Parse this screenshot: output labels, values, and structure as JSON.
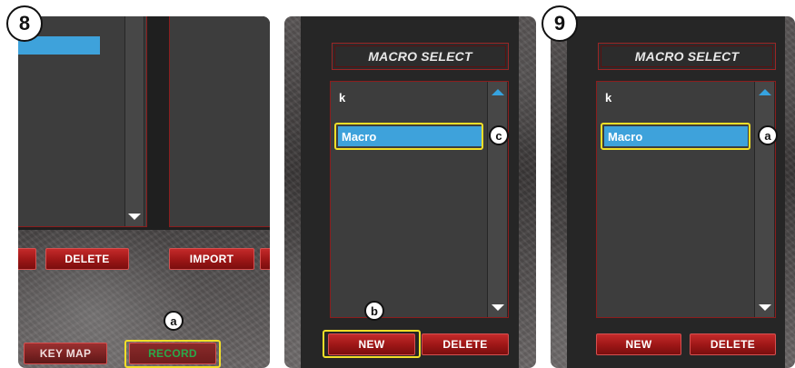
{
  "step8": {
    "badge": "8",
    "buttons": {
      "delete_label": "DELETE",
      "import_label": "IMPORT",
      "keymap_label": "KEY MAP",
      "record_label": "RECORD"
    },
    "callouts": {
      "a": "a"
    }
  },
  "panel_macro": {
    "title": "MACRO SELECT",
    "items": [
      {
        "label": "k"
      },
      {
        "label": "Macro"
      }
    ],
    "buttons": {
      "new_label": "NEW",
      "delete_label": "DELETE"
    },
    "callouts": {
      "b": "b",
      "c": "c"
    }
  },
  "step9": {
    "badge": "9",
    "title": "MACRO SELECT",
    "items": [
      {
        "label": "k"
      },
      {
        "label": "Macro"
      }
    ],
    "buttons": {
      "new_label": "NEW",
      "delete_label": "DELETE"
    },
    "callouts": {
      "a": "a"
    }
  },
  "colors": {
    "accent_red": "#9c1616",
    "selection_blue": "#3ea2db",
    "highlight_yellow": "#f2df28",
    "record_green": "#2aa84a"
  }
}
